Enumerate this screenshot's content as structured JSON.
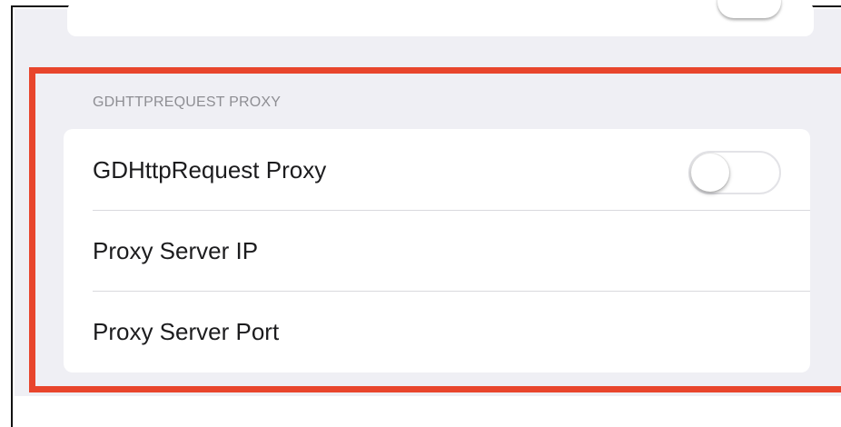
{
  "section": {
    "header": "GDHTTPREQUEST PROXY"
  },
  "rows": [
    {
      "label": "GDHttpRequest Proxy",
      "control": "toggle",
      "toggle_on": false
    },
    {
      "label": "Proxy Server IP"
    },
    {
      "label": "Proxy Server Port"
    }
  ],
  "colors": {
    "highlight": "#e8452c",
    "background": "#efeff4",
    "card": "#ffffff",
    "header_text": "#8e8e93"
  }
}
